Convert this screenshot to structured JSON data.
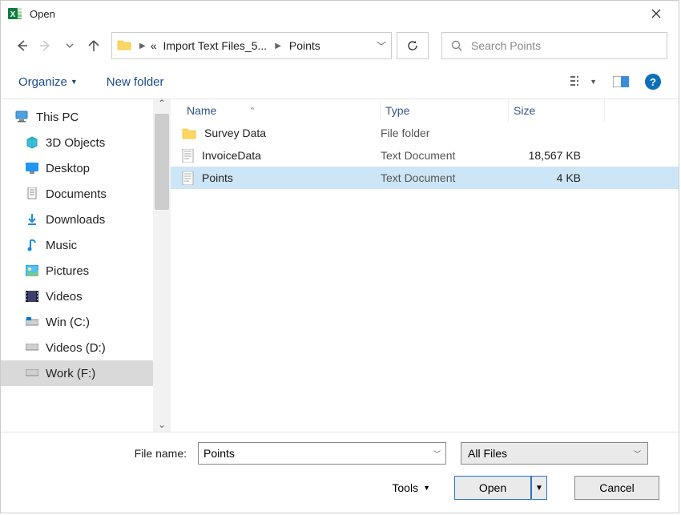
{
  "title": "Open",
  "breadcrumbs": {
    "first": "Import Text Files_5...",
    "second": "Points"
  },
  "search": {
    "placeholder": "Search Points"
  },
  "toolbar": {
    "organize": "Organize",
    "new_folder": "New folder"
  },
  "columns": {
    "name": "Name",
    "type": "Type",
    "size": "Size"
  },
  "tree": {
    "this_pc": "This PC",
    "objects3d": "3D Objects",
    "desktop": "Desktop",
    "documents": "Documents",
    "downloads": "Downloads",
    "music": "Music",
    "pictures": "Pictures",
    "videos": "Videos",
    "win_c": "Win (C:)",
    "videos_d": "Videos (D:)",
    "work_f": "Work (F:)"
  },
  "files": [
    {
      "name": "Survey Data",
      "type": "File folder",
      "size": ""
    },
    {
      "name": "InvoiceData",
      "type": "Text Document",
      "size": "18,567 KB"
    },
    {
      "name": "Points",
      "type": "Text Document",
      "size": "4 KB"
    }
  ],
  "footer": {
    "filename_label": "File name:",
    "filename_value": "Points",
    "filter": "All Files",
    "tools": "Tools",
    "open": "Open",
    "cancel": "Cancel"
  }
}
